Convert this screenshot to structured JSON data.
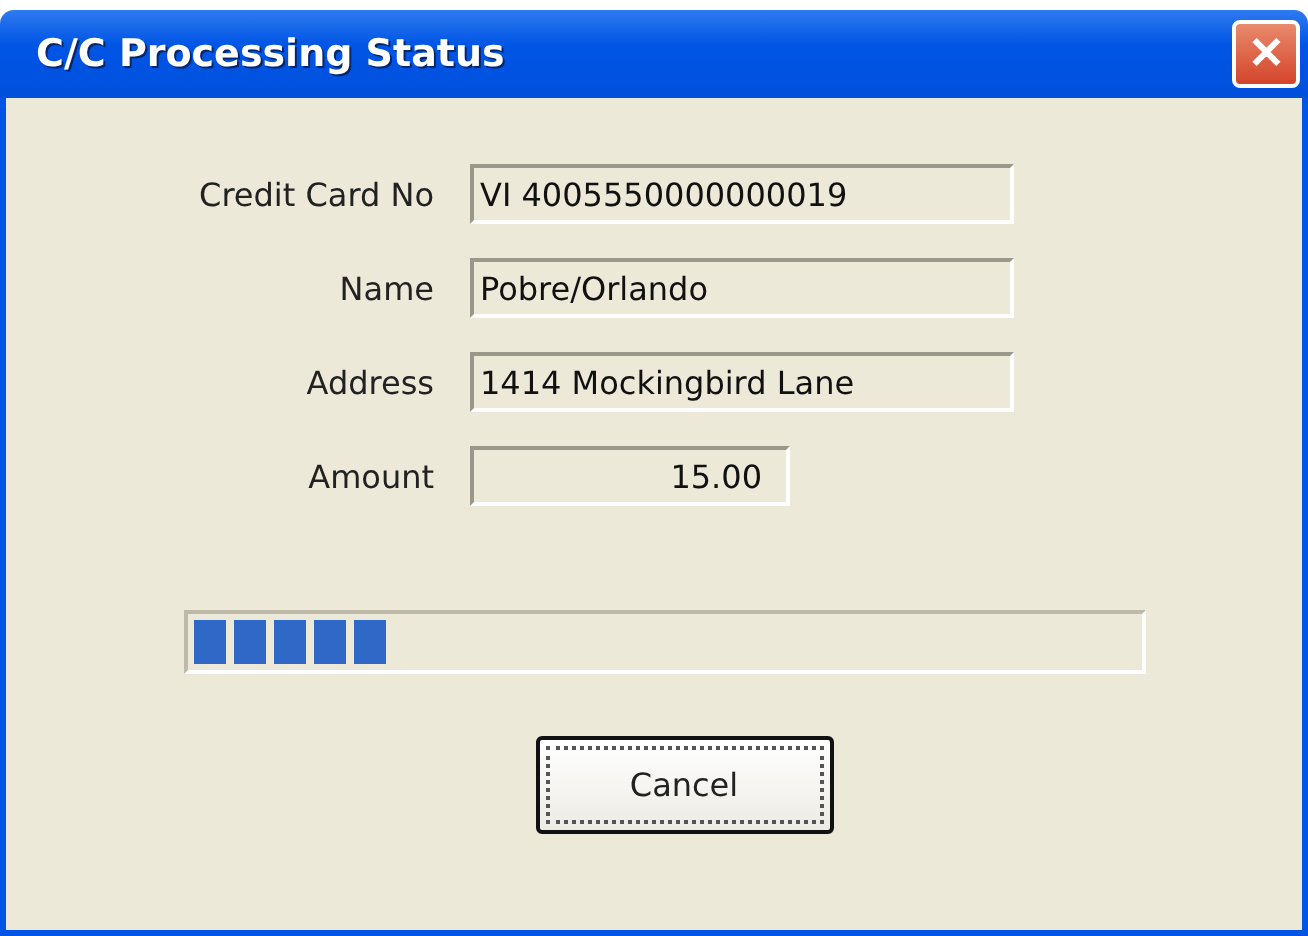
{
  "window": {
    "title": "C/C Processing Status",
    "close": "✕"
  },
  "fields": [
    {
      "label": "Credit Card No",
      "value": "VI 4005550000000019",
      "kind": "text"
    },
    {
      "label": "Name",
      "value": "Pobre/Orlando",
      "kind": "text"
    },
    {
      "label": "Address",
      "value": "1414 Mockingbird Lane",
      "kind": "text"
    },
    {
      "label": "Amount",
      "value": "15.00",
      "kind": "amount"
    }
  ],
  "progress": {
    "level": 0.21
  },
  "buttons": [
    {
      "label": "Cancel",
      "focused": true
    }
  ]
}
